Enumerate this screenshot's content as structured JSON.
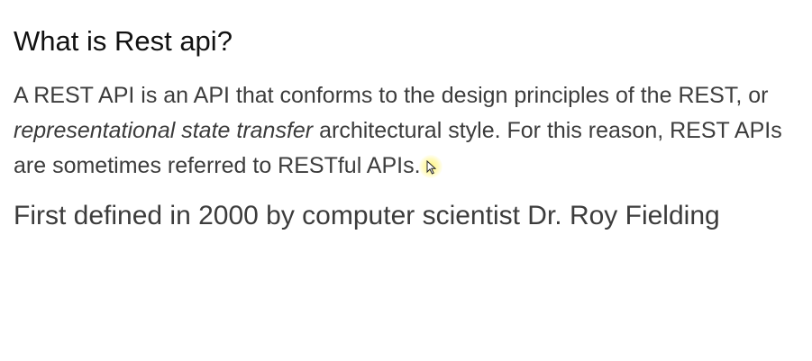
{
  "heading": "What is Rest api?",
  "paragraph": {
    "part1": "A REST API is an API that conforms to the design principles of the REST, or ",
    "emphasis": "representational state transfer",
    "part2": " architectural style. For this reason, REST APIs are sometimes referred to RESTful APIs."
  },
  "fact": "First defined in 2000 by computer scientist Dr. Roy Fielding",
  "cursor": {
    "icon": "mouse-pointer-icon",
    "highlight_color": "#fff578"
  }
}
